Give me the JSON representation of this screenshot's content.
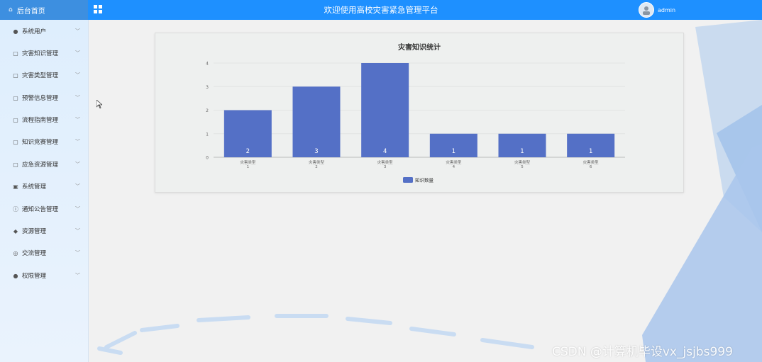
{
  "header": {
    "brand_label": "后台首页",
    "title": "欢迎使用高校灾害紧急管理平台",
    "username": "admin"
  },
  "sidebar": {
    "items": [
      {
        "label": "系统用户",
        "icon": "user-icon"
      },
      {
        "label": "灾害知识管理",
        "icon": "document-icon"
      },
      {
        "label": "灾害类型管理",
        "icon": "document-icon"
      },
      {
        "label": "预警信息管理",
        "icon": "document-icon"
      },
      {
        "label": "流程指南管理",
        "icon": "document-icon"
      },
      {
        "label": "知识竞赛管理",
        "icon": "document-icon"
      },
      {
        "label": "应急资源管理",
        "icon": "document-icon"
      },
      {
        "label": "系统管理",
        "icon": "image-icon"
      },
      {
        "label": "通知公告管理",
        "icon": "info-icon"
      },
      {
        "label": "资源管理",
        "icon": "location-icon"
      },
      {
        "label": "交流管理",
        "icon": "chat-icon"
      },
      {
        "label": "权限管理",
        "icon": "user-icon"
      }
    ]
  },
  "chart_data": {
    "type": "bar",
    "title": "灾害知识统计",
    "categories": [
      [
        "灾害类型",
        "1"
      ],
      [
        "灾害类型",
        "2"
      ],
      [
        "灾害类型",
        "3"
      ],
      [
        "灾害类型",
        "4"
      ],
      [
        "灾害类型",
        "5"
      ],
      [
        "灾害类型",
        "6"
      ]
    ],
    "series": [
      {
        "name": "知识数量",
        "values": [
          2,
          3,
          4,
          1,
          1,
          1
        ],
        "color": "#5470c6"
      }
    ],
    "ylim": [
      0,
      4
    ],
    "yticks": [
      "0",
      "1",
      "2",
      "3",
      "4"
    ],
    "grid": true,
    "legend": "bottom-center"
  },
  "watermark": "CSDN @计算机毕设vx_jsjbs999",
  "colors": {
    "header": "#1e90ff",
    "bar": "#5470c6"
  }
}
